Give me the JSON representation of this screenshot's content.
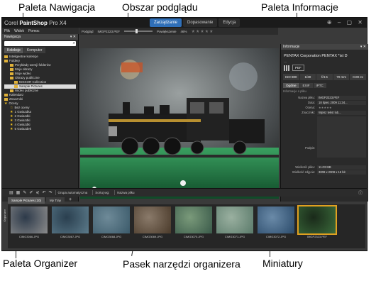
{
  "callouts": {
    "nav_palette": "Paleta Nawigacja",
    "preview_area": "Obszar podglądu",
    "info_palette": "Paleta Informacje",
    "organizer_palette": "Paleta Organizer",
    "organizer_toolbar": "Pasek narzędzi organizera",
    "thumbnails": "Miniatury"
  },
  "app": {
    "brand_prefix": "Corel ",
    "brand_name": "PaintShop",
    "brand_suffix": " Pro X4",
    "mode_tabs": [
      "Zarządzanie",
      "Dopasowanie",
      "Edycja"
    ],
    "window_controls": "⊕ – ▢ ✕"
  },
  "menu": [
    "Plik",
    "Widok",
    "Pomoc"
  ],
  "navigation": {
    "title": "Nawigacja",
    "tabs": [
      "Kolekcje",
      "Komputer"
    ],
    "tree": [
      "Inteligentne kolekcje",
      "Foldery",
      "Przykłady wersji folderów",
      "Moje obrazy",
      "Moje wideo",
      "Obrazy publiczne",
      "NIKKOR Collection",
      "Sample Pictures",
      "Wideo publiczne",
      "Kalendarz",
      "Znaczniki",
      "Oceny",
      "Bez oceny",
      "1 Gwiazdka",
      "2 Gwiazdki",
      "3 Gwiazdki",
      "4 Gwiazdki",
      "5 Gwiazdek"
    ]
  },
  "preview_toolbar": {
    "label": "Podgląd",
    "filename": "IMGP2323.PEF",
    "zoom_label": "Powiększenie",
    "zoom_value": "46%",
    "rating": "★★★★★"
  },
  "info": {
    "title": "Informacje",
    "camera": "PENTAX Corporation PENTAX *ist D",
    "camera_sub": "---",
    "format": "PEF",
    "exposure": [
      "ISO 800",
      "1/30",
      "f/4.5",
      "70 mm",
      "0.00 ev"
    ],
    "tabs": [
      "Ogólne",
      "EXIF",
      "IPTC"
    ],
    "section": "Informacje o pliku",
    "fields": [
      {
        "label": "Nazwa pliku:",
        "value": "IMGP2323.PEF"
      },
      {
        "label": "Data:",
        "value": "18 lipiec 2009 11:34..."
      },
      {
        "label": "Ocena:",
        "value": "★★★★★"
      },
      {
        "label": "Znaczniki:",
        "value": "Wpisz tekst lub..."
      }
    ],
    "caption_label": "Podpis:",
    "size_label": "Wielkość pliku:",
    "size_value": "11.03 MB",
    "dims_label": "Wielkość zdjęcia:",
    "dims_value": "3008 x 2008 x 16 bit"
  },
  "organizer": {
    "toolbar_items": [
      "Grupa automatyczna",
      "Sortuj wg:",
      "Nazwa pliku"
    ],
    "tabs": [
      "Sample Pictures (10)",
      "My Tray"
    ],
    "add": "+",
    "side_label": "Organizer",
    "thumbnails": [
      {
        "name": "CIMG3066.JPG",
        "color1": "#8b8b8b",
        "color2": "#2d3a4a"
      },
      {
        "name": "CIMG3067.JPG",
        "color1": "#5b7a8a",
        "color2": "#2a3f4f"
      },
      {
        "name": "CIMG3068.JPG",
        "color1": "#3b5a6a",
        "color2": "#6e8a98"
      },
      {
        "name": "CIMG3069.JPG",
        "color1": "#4a3a2a",
        "color2": "#8a7a6a"
      },
      {
        "name": "CIMG3070.JPG",
        "color1": "#3a5a4a",
        "color2": "#7a9a7a"
      },
      {
        "name": "CIMG3071.JPG",
        "color1": "#5a7a6a",
        "color2": "#9ab0a0"
      },
      {
        "name": "CIMG3072.JPG",
        "color1": "#2a4a6a",
        "color2": "#6a8aa8"
      },
      {
        "name": "IMGP2323.PEF",
        "color1": "#3a6a3a",
        "color2": "#1a2a1a"
      }
    ]
  }
}
